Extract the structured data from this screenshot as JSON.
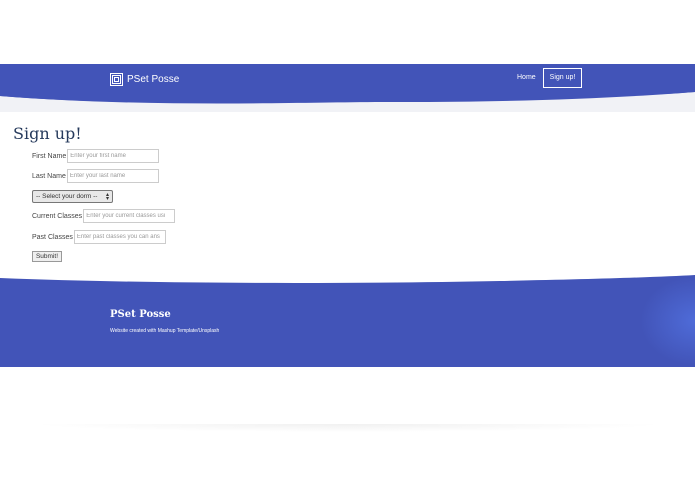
{
  "header": {
    "brand": "PSet Posse",
    "nav": {
      "home": "Home",
      "signup": "Sign up!"
    }
  },
  "page": {
    "title": "Sign up!"
  },
  "form": {
    "first_name": {
      "label": "First Name",
      "placeholder": "Enter your first name"
    },
    "last_name": {
      "label": "Last Name",
      "placeholder": "Enter your last name"
    },
    "dorm": {
      "selected": "-- Select your dorm --"
    },
    "current_classes": {
      "label": "Current Classes",
      "placeholder": "Enter your current classes usi"
    },
    "past_classes": {
      "label": "Past Classes",
      "placeholder": "Enter past classes you can ans"
    },
    "submit": "Submit!"
  },
  "footer": {
    "title": "PSet Posse",
    "credit": "Website created with Mashup Template/Unsplash"
  },
  "colors": {
    "brand_blue": "#4254b8",
    "title": "#263a5c"
  }
}
